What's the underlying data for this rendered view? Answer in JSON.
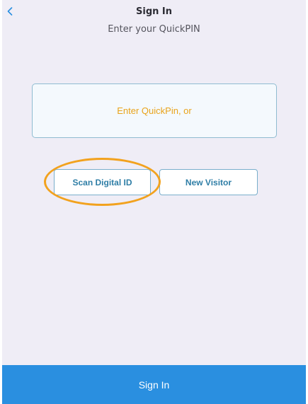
{
  "header": {
    "back_icon": "chevron-left-icon",
    "title": "Sign In",
    "subtitle": "Enter your QuickPIN"
  },
  "pin_field": {
    "placeholder": "Enter QuickPin, or",
    "value": ""
  },
  "actions": {
    "scan_label": "Scan Digital ID",
    "new_visitor_label": "New Visitor"
  },
  "footer": {
    "sign_in_label": "Sign In"
  },
  "colors": {
    "accent": "#2a8fe0",
    "placeholder": "#e9a31a",
    "highlight": "#f2a21e",
    "background": "#efedf6"
  }
}
